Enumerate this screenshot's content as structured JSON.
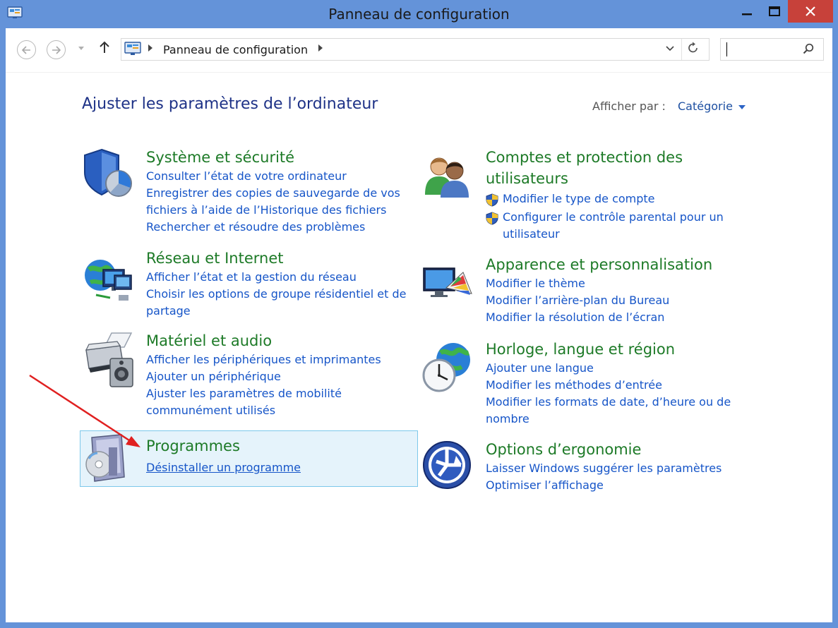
{
  "window": {
    "title": "Panneau de configuration"
  },
  "navigation": {
    "breadcrumb": "Panneau de configuration",
    "search_value": ""
  },
  "header": {
    "title": "Ajuster les paramètres de l’ordinateur",
    "view_label": "Afficher par :",
    "view_value": "Catégorie"
  },
  "categories": [
    {
      "title": "Système et sécurité",
      "links": [
        "Consulter l’état de votre ordinateur",
        "Enregistrer des copies de sauvegarde de vos",
        "fichiers à l’aide de l’Historique des fichiers",
        "Rechercher et résoudre des problèmes"
      ]
    },
    {
      "title": "Réseau et Internet",
      "links": [
        "Afficher l’état et la gestion du réseau",
        "Choisir les options de groupe résidentiel et de",
        "partage"
      ]
    },
    {
      "title": "Matériel et audio",
      "links": [
        "Afficher les périphériques et imprimantes",
        "Ajouter un périphérique",
        "Ajuster les paramètres de mobilité",
        "communément utilisés"
      ]
    },
    {
      "title": "Programmes",
      "links": [
        "Désinstaller un programme"
      ]
    },
    {
      "title_line1": "Comptes et protection des",
      "title_line2": "utilisateurs",
      "links": [
        "Modifier le type de compte",
        "Configurer le contrôle parental pour un",
        "utilisateur"
      ]
    },
    {
      "title": "Apparence et personnalisation",
      "links": [
        "Modifier le thème",
        "Modifier l’arrière-plan du Bureau",
        "Modifier la résolution de l’écran"
      ]
    },
    {
      "title": "Horloge, langue et région",
      "links": [
        "Ajouter une langue",
        "Modifier les méthodes d’entrée",
        "Modifier les formats de date, d’heure ou de",
        "nombre"
      ]
    },
    {
      "title": "Options d’ergonomie",
      "links": [
        "Laisser Windows suggérer les paramètres",
        "Optimiser l’affichage"
      ]
    }
  ],
  "colors": {
    "title_bar": "#6493d9",
    "close_button": "#c7413a",
    "category_title": "#1d7a27",
    "link": "#1655c8",
    "highlight": "#e5f3fb",
    "annotation_arrow": "#e02020"
  }
}
